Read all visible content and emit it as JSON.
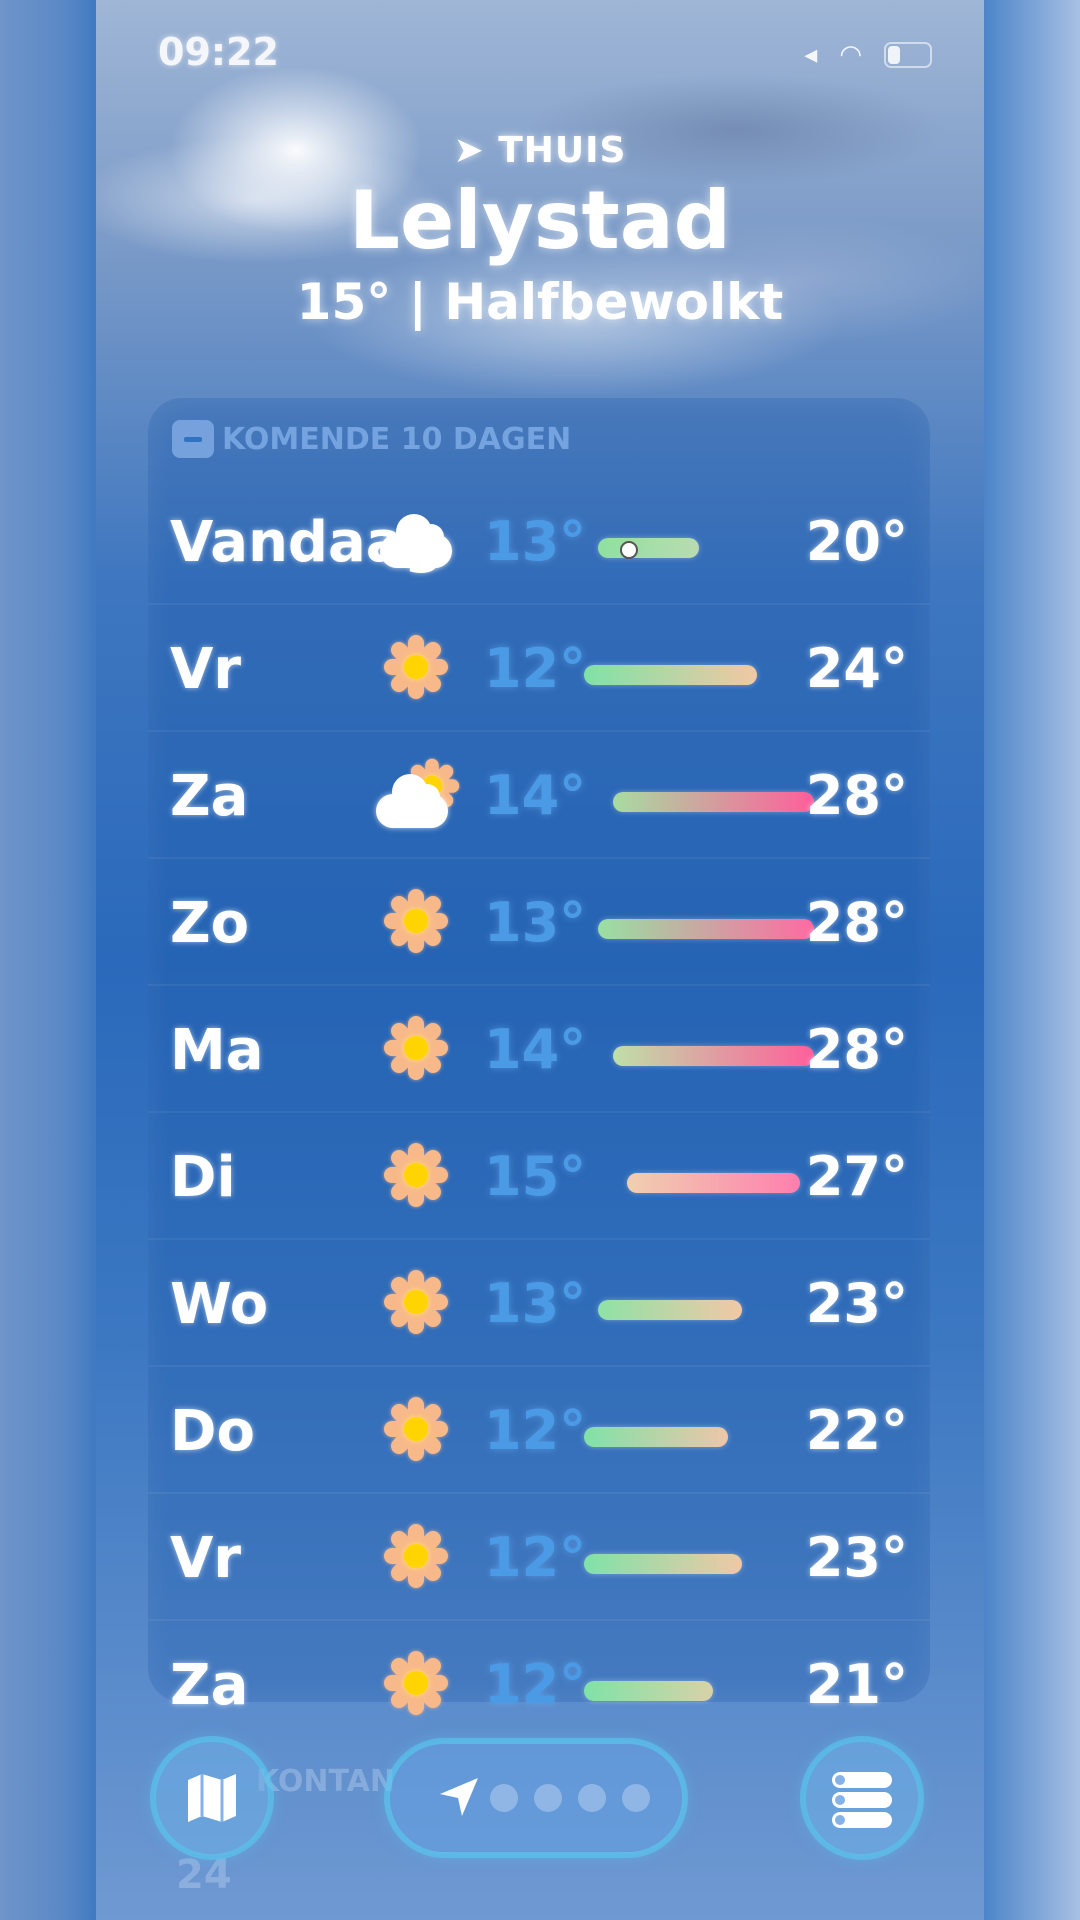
{
  "status_bar": {
    "time": "09:22"
  },
  "header": {
    "home_label": "THUIS",
    "city": "Lelystad",
    "summary": "15° | Halfbewolkt"
  },
  "forecast": {
    "title": "KOMENDE 10 DAGEN",
    "range_min": 12,
    "range_max": 28,
    "days": [
      {
        "day": "Vandaag",
        "icon": "cloud-icon",
        "low": "13°",
        "high": "20°",
        "low_v": 13,
        "high_v": 20,
        "current": 15,
        "colors": [
          "#8fe0a0",
          "#b9dcb0"
        ]
      },
      {
        "day": "Vr",
        "icon": "sun-icon",
        "low": "12°",
        "high": "24°",
        "low_v": 12,
        "high_v": 24,
        "colors": [
          "#7fe2a8",
          "#f2c8a2"
        ]
      },
      {
        "day": "Za",
        "icon": "partly-cloudy-icon",
        "low": "14°",
        "high": "28°",
        "low_v": 14,
        "high_v": 28,
        "colors": [
          "#a8dca0",
          "#ff5e9a"
        ]
      },
      {
        "day": "Zo",
        "icon": "sun-icon",
        "low": "13°",
        "high": "28°",
        "low_v": 13,
        "high_v": 28,
        "colors": [
          "#98e0a2",
          "#ff6aa2"
        ]
      },
      {
        "day": "Ma",
        "icon": "sun-icon",
        "low": "14°",
        "high": "28°",
        "low_v": 14,
        "high_v": 28,
        "colors": [
          "#bfe0a8",
          "#ff5e9a"
        ]
      },
      {
        "day": "Di",
        "icon": "sun-icon",
        "low": "15°",
        "high": "27°",
        "low_v": 15,
        "high_v": 27,
        "colors": [
          "#f0d0b0",
          "#ff7fae"
        ]
      },
      {
        "day": "Wo",
        "icon": "sun-icon",
        "low": "13°",
        "high": "23°",
        "low_v": 13,
        "high_v": 23,
        "colors": [
          "#8ee2a6",
          "#f2c8a6"
        ]
      },
      {
        "day": "Do",
        "icon": "sun-icon",
        "low": "12°",
        "high": "22°",
        "low_v": 12,
        "high_v": 22,
        "colors": [
          "#7fe2a8",
          "#eec6a8"
        ]
      },
      {
        "day": "Vr",
        "icon": "sun-icon",
        "low": "12°",
        "high": "23°",
        "low_v": 12,
        "high_v": 23,
        "colors": [
          "#7fe2a8",
          "#f0c8a6"
        ]
      },
      {
        "day": "Za",
        "icon": "sun-icon",
        "low": "12°",
        "high": "21°",
        "low_v": 12,
        "high_v": 21,
        "colors": [
          "#7fe2a8",
          "#d8d2a8"
        ]
      }
    ]
  },
  "toolbar": {
    "ghost_text": "KONTAN",
    "ghost_number": "24",
    "page_count": 4,
    "map_icon": "map-icon",
    "location_icon": "location-arrow-icon",
    "list_icon": "list-icon"
  }
}
